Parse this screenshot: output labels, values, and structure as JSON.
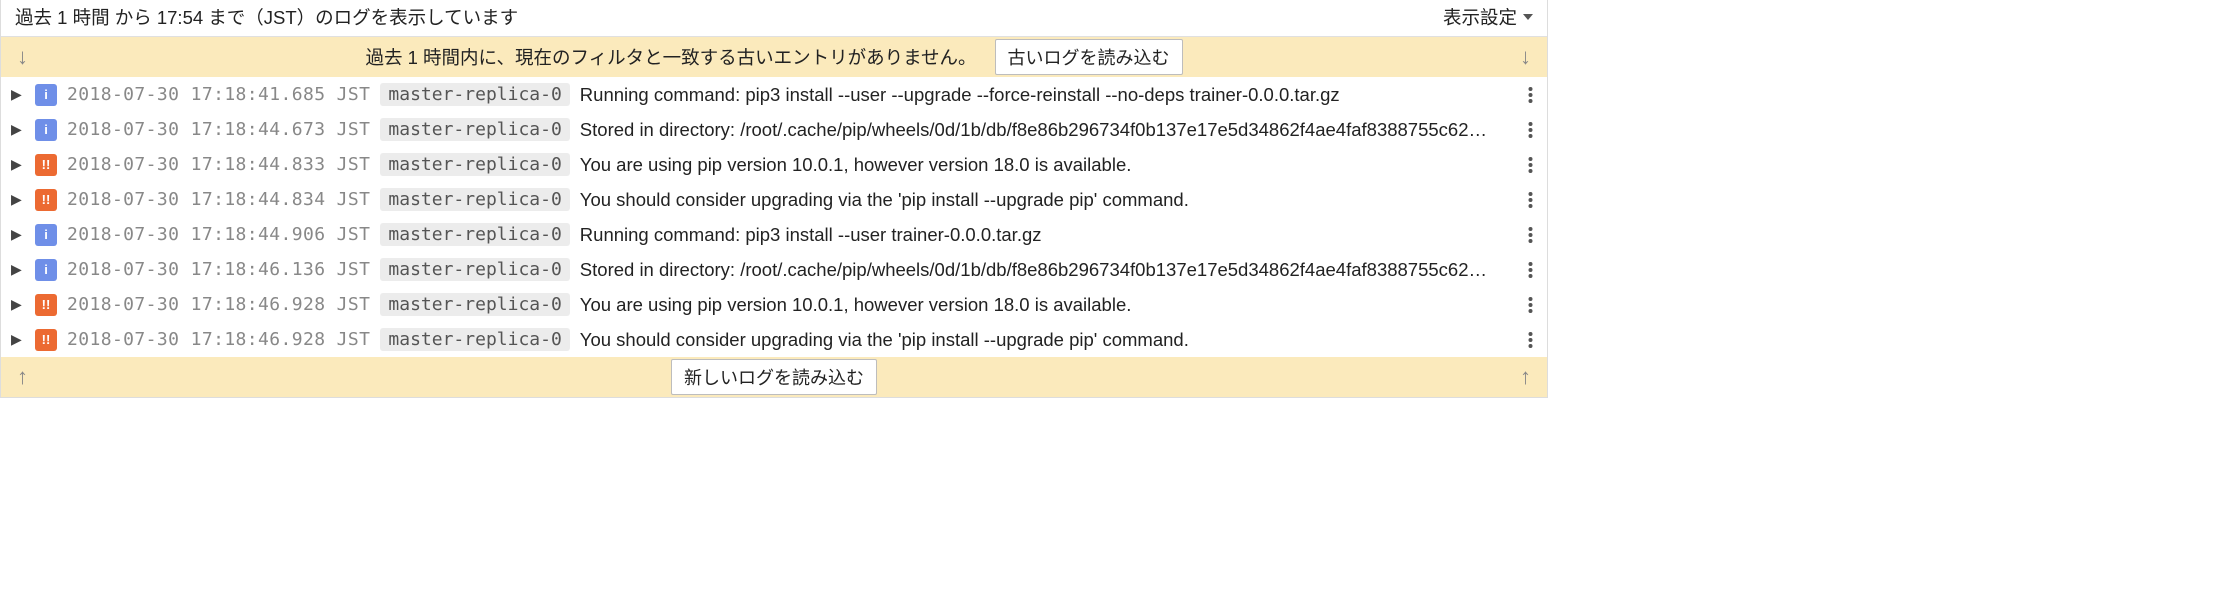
{
  "toolbar": {
    "status_text": "過去 1 時間 から 17:54 まで（JST）のログを表示しています",
    "settings_label": "表示設定"
  },
  "banner_top": {
    "message": "過去 1 時間内に、現在のフィルタと一致する古いエントリがありません。",
    "button": "古いログを読み込む"
  },
  "banner_bottom": {
    "button": "新しいログを読み込む"
  },
  "level_glyph": {
    "info": "i",
    "warn": "!!"
  },
  "rows": [
    {
      "level": "info",
      "ts": "2018-07-30 17:18:41.685 JST",
      "replica": "master-replica-0",
      "msg": "Running command: pip3 install --user --upgrade --force-reinstall --no-deps trainer-0.0.0.tar.gz"
    },
    {
      "level": "info",
      "ts": "2018-07-30 17:18:44.673 JST",
      "replica": "master-replica-0",
      "msg": "Stored in directory: /root/.cache/pip/wheels/0d/1b/db/f8e86b296734f0b137e17e5d34862f4ae4faf8388755c62…"
    },
    {
      "level": "warn",
      "ts": "2018-07-30 17:18:44.833 JST",
      "replica": "master-replica-0",
      "msg": "You are using pip version 10.0.1, however version 18.0 is available."
    },
    {
      "level": "warn",
      "ts": "2018-07-30 17:18:44.834 JST",
      "replica": "master-replica-0",
      "msg": "You should consider upgrading via the 'pip install --upgrade pip' command."
    },
    {
      "level": "info",
      "ts": "2018-07-30 17:18:44.906 JST",
      "replica": "master-replica-0",
      "msg": "Running command: pip3 install --user trainer-0.0.0.tar.gz"
    },
    {
      "level": "info",
      "ts": "2018-07-30 17:18:46.136 JST",
      "replica": "master-replica-0",
      "msg": "Stored in directory: /root/.cache/pip/wheels/0d/1b/db/f8e86b296734f0b137e17e5d34862f4ae4faf8388755c62…"
    },
    {
      "level": "warn",
      "ts": "2018-07-30 17:18:46.928 JST",
      "replica": "master-replica-0",
      "msg": "You are using pip version 10.0.1, however version 18.0 is available."
    },
    {
      "level": "warn",
      "ts": "2018-07-30 17:18:46.928 JST",
      "replica": "master-replica-0",
      "msg": "You should consider upgrading via the 'pip install --upgrade pip' command."
    }
  ]
}
